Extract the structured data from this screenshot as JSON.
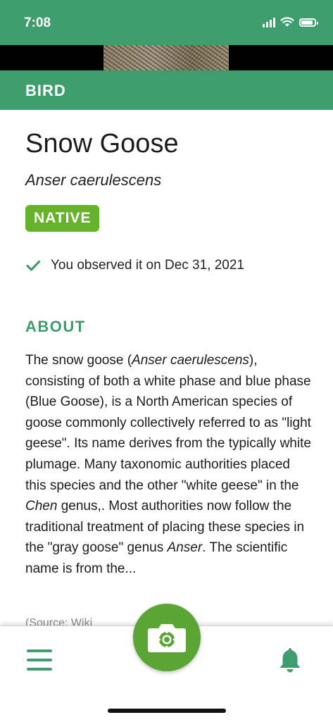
{
  "status_bar": {
    "time": "7:08"
  },
  "category": {
    "label": "BIRD"
  },
  "species": {
    "common_name": "Snow Goose",
    "scientific_name": "Anser caerulescens",
    "status_badge": "NATIVE",
    "observed_text": "You observed it on Dec 31, 2021"
  },
  "about": {
    "heading": "ABOUT",
    "text_1": "The snow goose (",
    "text_italic_1": "Anser caerulescens",
    "text_2": "), consisting of both a white phase and blue phase (Blue Goose), is a North American species of goose commonly collectively referred to as \"light geese\". Its name derives from the typically white plumage. Many taxonomic authorities placed this species and the other \"white geese\" in the ",
    "text_italic_2": "Chen",
    "text_3": " genus,. Most authorities now follow the traditional treatment of placing these species in the \"gray goose\" genus ",
    "text_italic_3": "Anser",
    "text_4": ". The scientific name is from the..."
  },
  "below_fold_text": "(Source: Wiki",
  "nav": {
    "menu_icon": "menu-icon",
    "camera_icon": "camera-icon",
    "bell_icon": "bell-icon"
  },
  "colors": {
    "header_green": "#3e9d6c",
    "badge_green": "#67b22c",
    "camera_green": "#5aa533"
  }
}
